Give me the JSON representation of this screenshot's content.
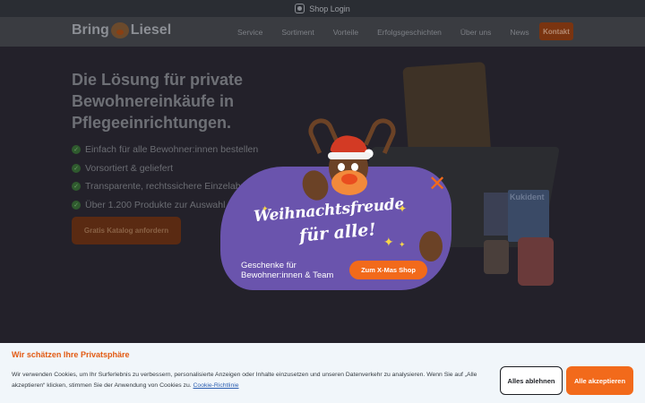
{
  "topbar": {
    "shop_login": "Shop Login",
    "icon": "shop-login-icon"
  },
  "nav": {
    "logo_left": "Bring",
    "logo_right": "Liesel",
    "links": [
      "Service",
      "Sortiment",
      "Vorteile",
      "Erfolgsgeschichten",
      "Über uns",
      "News"
    ],
    "contact": "Kontakt"
  },
  "hero": {
    "headline": "Die Lösung für private Bewohnereinkäufe in Pflegeeinrichtungen.",
    "bullets": [
      "Einfach für alle Bewohner:innen bestellen",
      "Vorsortiert & geliefert",
      "Transparente, rechtssichere Einzelabrechnung",
      "Über 1.200 Produkte zur Auswahl"
    ],
    "cta": "Gratis Katalog anfordern",
    "product_label": "Kukident"
  },
  "popup": {
    "headline_line1": "Weihnachtsfreude",
    "headline_line2": "für alle!",
    "subtext": "Geschenke für Bewohner:innen & Team",
    "button": "Zum X-Mas Shop",
    "close_symbol": "✕"
  },
  "cookie": {
    "title": "Wir schätzen Ihre Privatsphäre",
    "text": "Wir verwenden Cookies, um Ihr Surferlebnis zu verbessern, personalisierte Anzeigen oder Inhalte einzusetzen und unseren Datenverkehr zu analysieren. Wenn Sie auf „Alle akzeptieren“ klicken, stimmen Sie der Anwendung von Cookies zu.",
    "link": "Cookie-Richtlinie",
    "decline": "Alles ablehnen",
    "accept": "Alle akzeptieren"
  },
  "colors": {
    "accent": "#f26a1b",
    "popup_bg": "#6a54ad",
    "cookie_title": "#e25a12"
  }
}
